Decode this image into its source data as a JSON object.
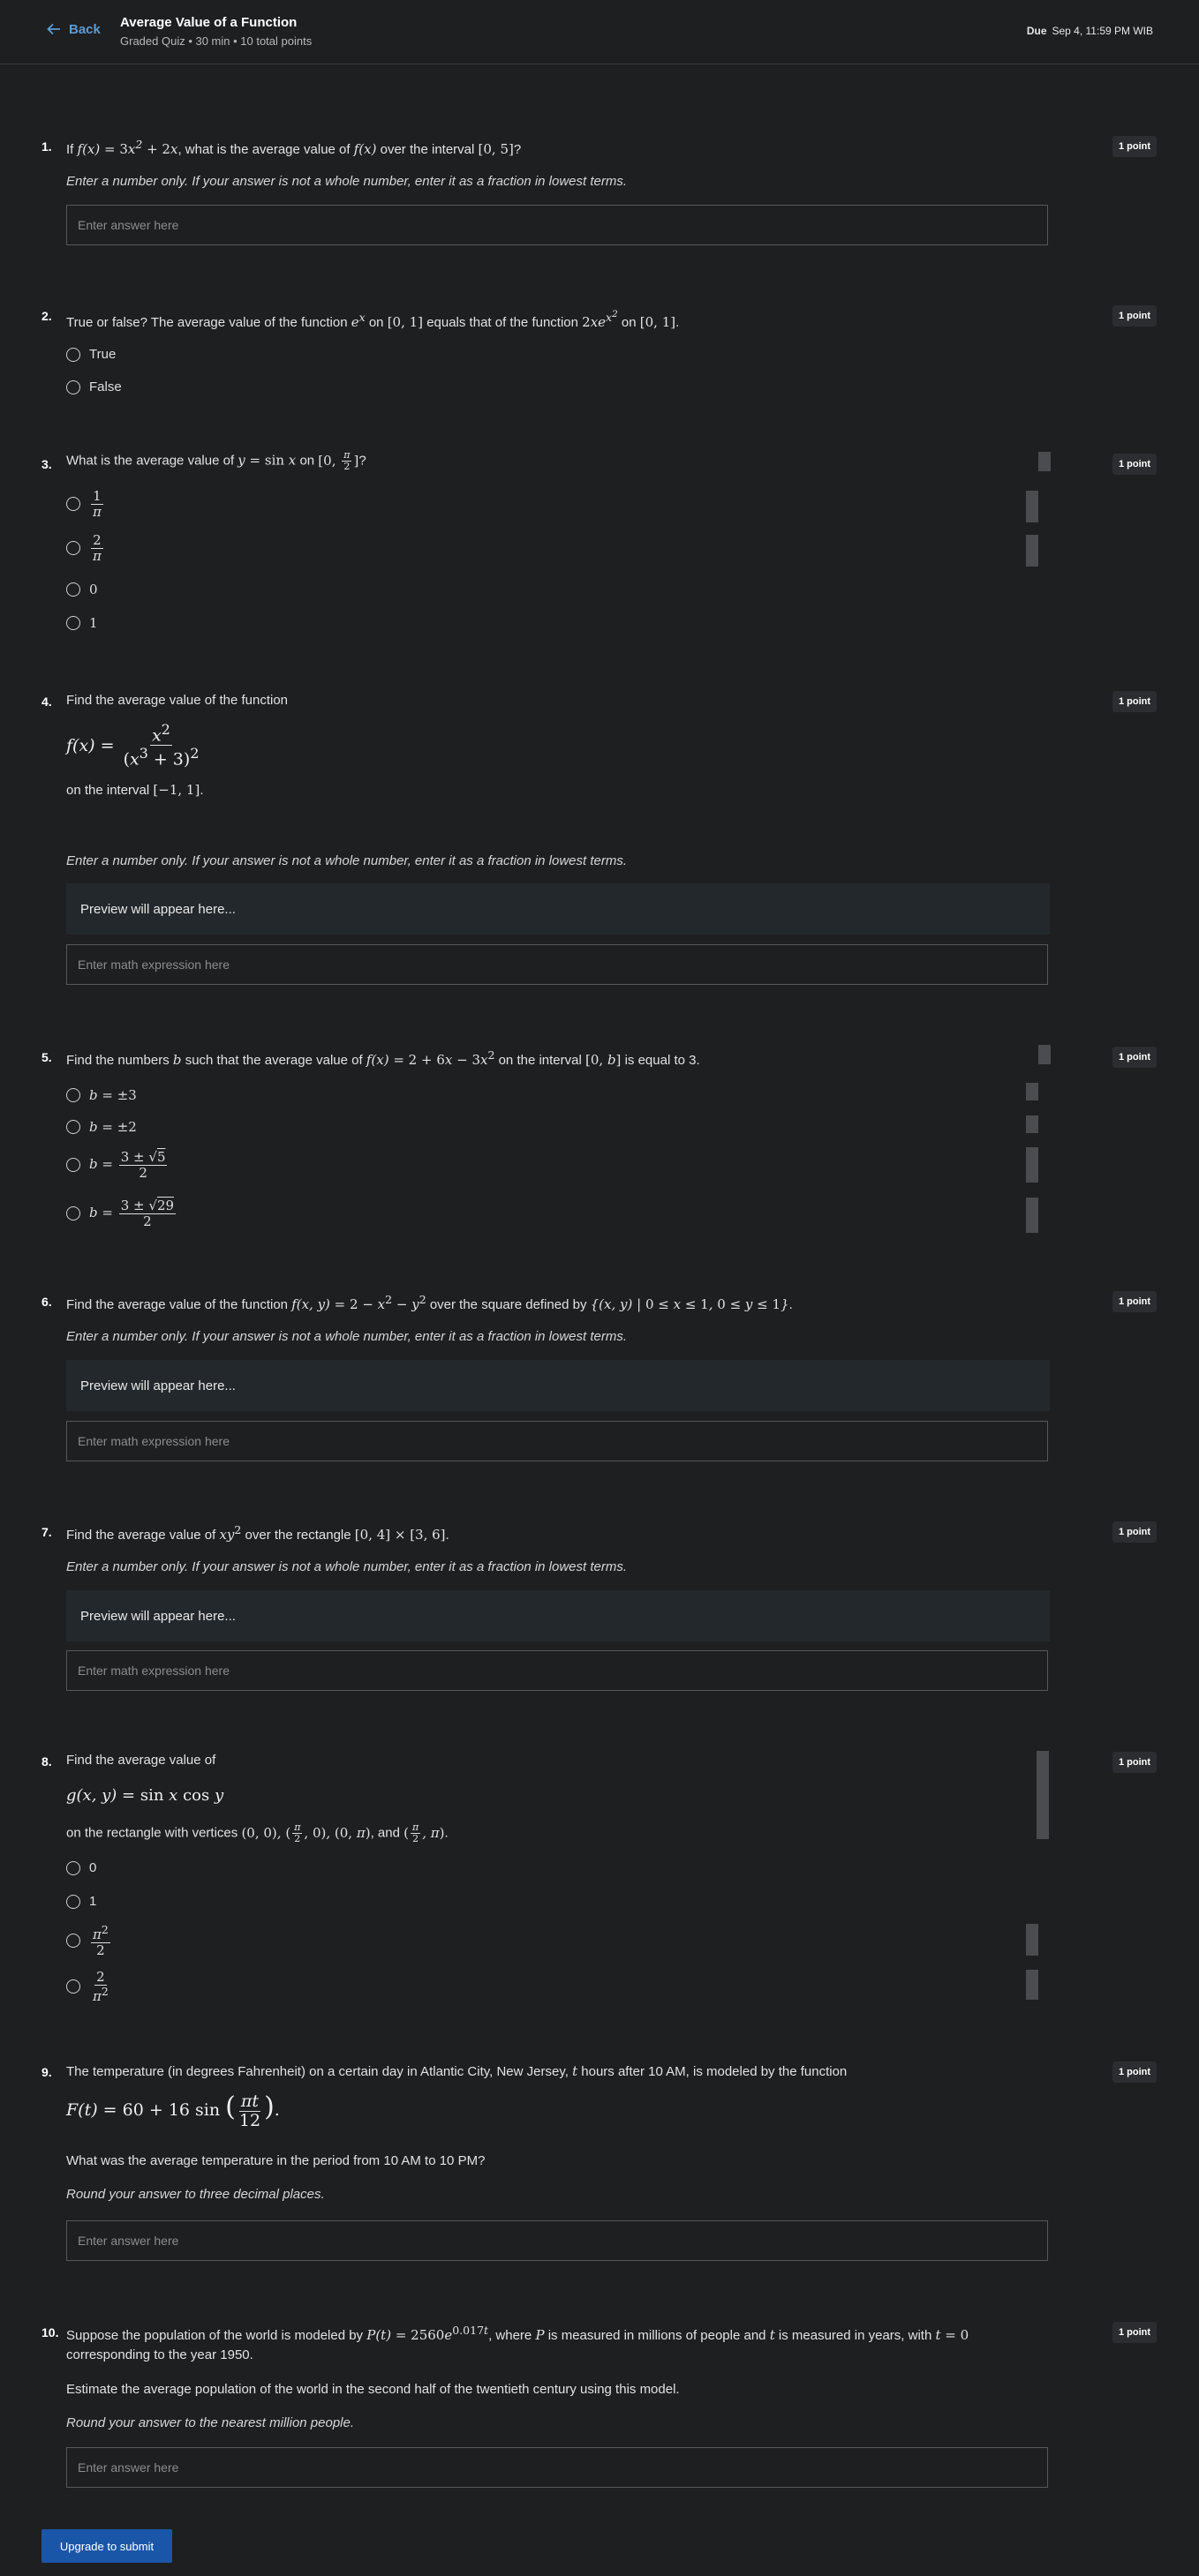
{
  "header": {
    "back": "Back",
    "title": "Average Value of a Function",
    "subtitle": "Graded Quiz • 30 min • 10 total points",
    "due_label": "Due",
    "due_value": "Sep 4, 11:59 PM WIB"
  },
  "common": {
    "points": "1 point",
    "instr_fraction": "Enter a number only. If your answer is not a whole number, enter it as a fraction in lowest terms.",
    "answer_placeholder": "Enter answer here",
    "math_placeholder": "Enter math expression here",
    "preview": "Preview will appear here..."
  },
  "questions": {
    "q1": {
      "num": "1.",
      "text_a": "If",
      "text_b": ", what is the average value of",
      "text_c": "over the interval",
      "text_d": "?"
    },
    "q2": {
      "num": "2.",
      "text_a": "True or false? The average value of the function",
      "text_b": "on",
      "text_c": "equals that of the function",
      "text_d": "on",
      "options": [
        "True",
        "False"
      ]
    },
    "q3": {
      "num": "3.",
      "text_a": "What is the average value of",
      "text_b": "on",
      "text_c": "?",
      "options": [
        "1/π",
        "2/π",
        "0",
        "1"
      ]
    },
    "q4": {
      "num": "4.",
      "text_a": "Find the average value of the function",
      "text_b": "on the interval"
    },
    "q5": {
      "num": "5.",
      "text_a": "Find the numbers",
      "text_b": "such that the average value of",
      "text_c": "on the interval",
      "text_d": "is equal to 3."
    },
    "q6": {
      "num": "6.",
      "text_a": "Find the average value of the function",
      "text_b": "over the square defined by"
    },
    "q7": {
      "num": "7.",
      "text_a": "Find the average value of",
      "text_b": "over the rectangle"
    },
    "q8": {
      "num": "8.",
      "text_a": "Find the average value of",
      "text_b": "on the rectangle with vertices",
      "text_c": "and",
      "options": [
        "0",
        "1",
        "π²/2",
        "2/π²"
      ]
    },
    "q9": {
      "num": "9.",
      "text_a": "The temperature (in degrees Fahrenheit) on a certain day  in Atlantic City, New Jersey,",
      "text_b": "hours after 10 AM, is modeled by the function",
      "text_c": "What was the average temperature in the period from 10 AM to 10 PM?",
      "instr": "Round your answer to three decimal places."
    },
    "q10": {
      "num": "10.",
      "text_a": "Suppose the population of the world is modeled by",
      "text_b": ", where",
      "text_c": "is measured in millions of people and",
      "text_d": "is measured in years, with",
      "text_e": "corresponding to the year 1950.",
      "text_f": "Estimate the average population of the world in the second half of the twentieth century using this model.",
      "instr": "Round your answer to the nearest million people."
    }
  },
  "footer": {
    "submit": "Upgrade to submit"
  }
}
